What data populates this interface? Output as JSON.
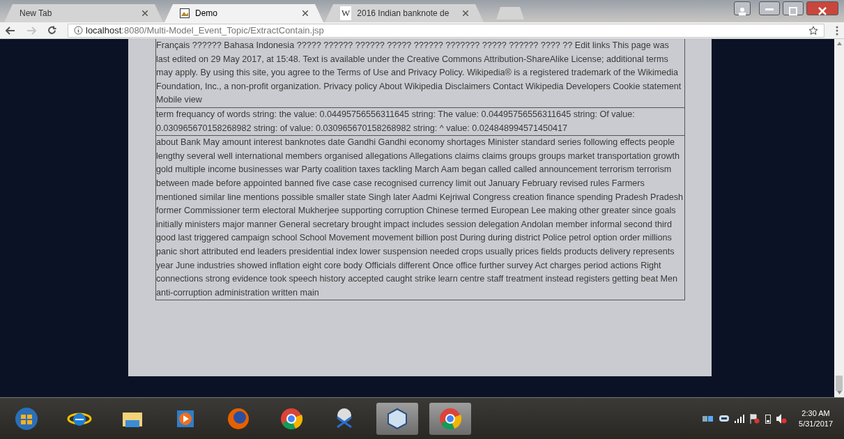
{
  "browser": {
    "tabs": [
      {
        "title": "New Tab",
        "selected": false,
        "kind": "plain"
      },
      {
        "title": "Demo",
        "selected": true,
        "kind": "image"
      },
      {
        "title": "2016 Indian banknote de",
        "selected": false,
        "kind": "letter",
        "favicon": "W"
      }
    ],
    "address": {
      "host": "localhost",
      "path": ":8080/Multi-Model_Event_Topic/ExtractContain.jsp"
    }
  },
  "content": {
    "rows": [
      "Français ?????? Bahasa Indonesia ????? ?????? ?????? ????? ?????? ??????? ????? ?????? ???? ?? Edit links This page was last edited on 29 May 2017, at 15:48. Text is available under the Creative Commons Attribution-ShareAlike License; additional terms may apply. By using this site, you agree to the Terms of Use and Privacy Policy. Wikipedia® is a registered trademark of the Wikimedia Foundation, Inc., a non-profit organization. Privacy policy About Wikipedia Disclaimers Contact Wikipedia Developers Cookie statement Mobile view",
      "term frequancy of words string: the value: 0.04495756556311645 string: The value: 0.04495756556311645 string: Of value: 0.030965670158268982 string: of value: 0.030965670158268982 string: ^ value: 0.024848994571450417",
      "about Bank May amount interest banknotes date Gandhi Gandhi economy shortages Minister standard series following effects people lengthy several well international members organised allegations Allegations claims claims groups groups market transportation growth gold multiple income businesses war Party coalition taxes tackling March Aam began called called announcement terrorism terrorism between made before appointed banned five case case recognised currency limit out January February revised rules Farmers mentioned similar line mentions possible smaller state Singh later Aadmi Kejriwal Congress creation finance spending Pradesh Pradesh former Commissioner term electoral Mukherjee supporting corruption Chinese termed European Lee making other greater since goals initially ministers major manner General secretary brought impact includes session delegation Andolan member informal second third good last triggered campaign school School Movement movement billion post During during district Police petrol option order millions panic short attributed end leaders presidential index lower suspension needed crops usually prices fields products delivery represents year June industries showed inflation eight core body Officials different Once office further survey Act charges period actions Right connections strong evidence took speech history accepted caught strike learn centre staff treatment instead registers getting beat Men anti-corruption administration written main"
    ]
  },
  "taskbar": {
    "apps": [
      {
        "kind": "start",
        "running": false
      },
      {
        "kind": "ie",
        "running": false
      },
      {
        "kind": "folder",
        "running": false
      },
      {
        "kind": "media",
        "running": false
      },
      {
        "kind": "firefox",
        "running": false
      },
      {
        "kind": "chrome",
        "running": false
      },
      {
        "kind": "snip",
        "running": false
      },
      {
        "kind": "cube",
        "running": true
      },
      {
        "kind": "chrome",
        "running": true
      }
    ],
    "clock": {
      "time": "2:30 AM",
      "date": "5/31/2017"
    }
  }
}
